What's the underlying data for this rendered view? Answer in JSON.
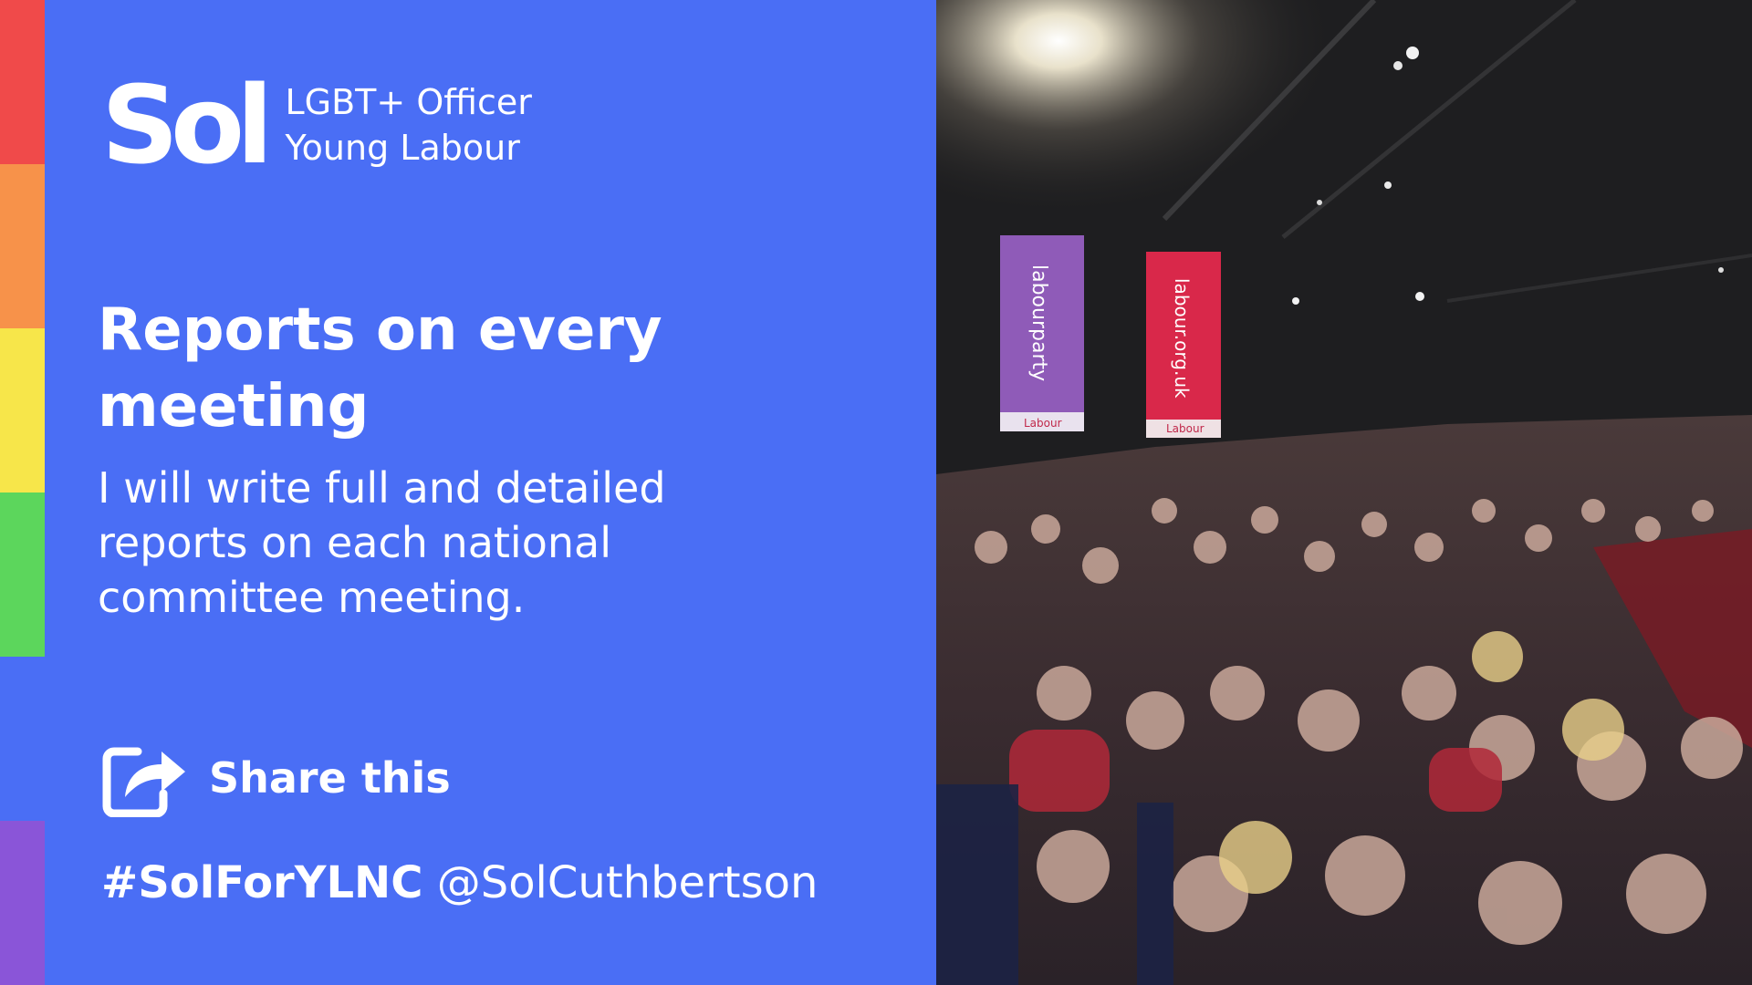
{
  "brand": {
    "logo_text": "Sol",
    "line1": "LGBT+ Officer",
    "line2": "Young Labour"
  },
  "headline": "Reports on every meeting",
  "body": "I will write full and detailed reports on each national committee meeting.",
  "share": {
    "icon": "share-icon",
    "label": "Share this"
  },
  "footer": {
    "hashtag": "#SolForYLNC",
    "handle": "@SolCuthbertson"
  },
  "photo": {
    "description_hidden": "",
    "banner_left": "labourparty",
    "banner_right": "labour.org.uk",
    "banner_footer": "Labour"
  },
  "colors": {
    "panel_bg": "#4a6ef5",
    "text": "#ffffff",
    "rainbow": [
      "#f04a4a",
      "#f7924a",
      "#f7e64a",
      "#5cd65c",
      "#4a6ef5",
      "#8a55d8"
    ]
  }
}
